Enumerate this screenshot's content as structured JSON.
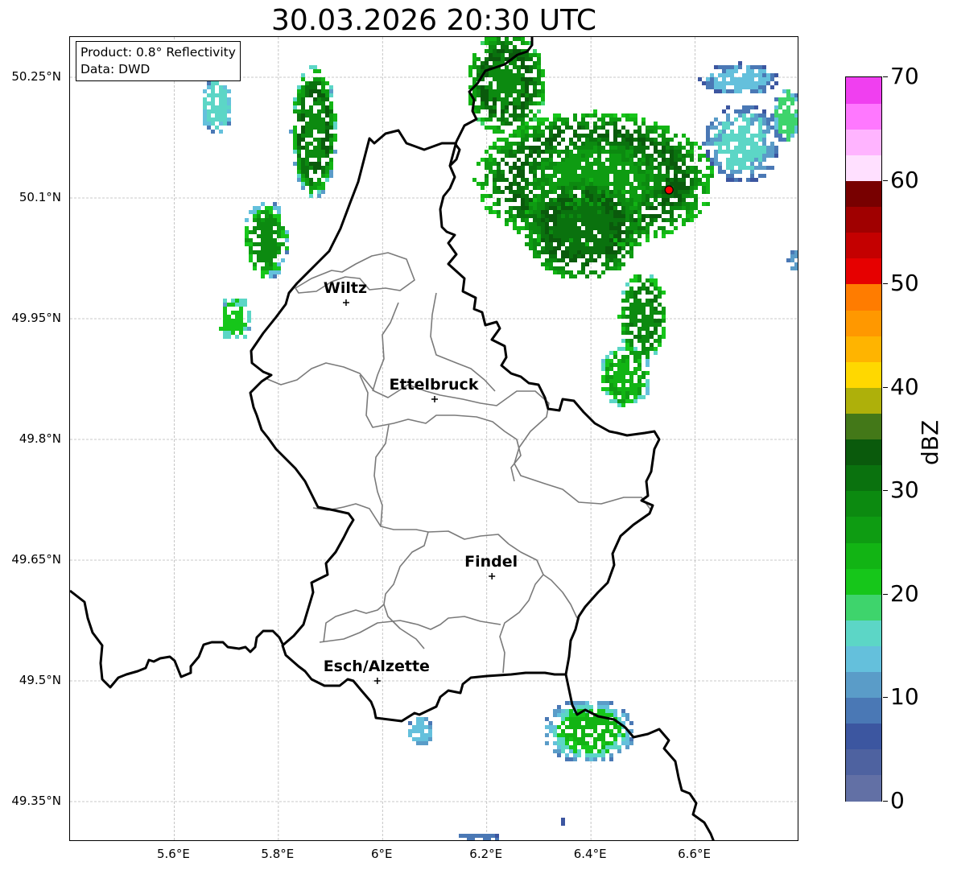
{
  "title": "30.03.2026 20:30 UTC",
  "info": {
    "product": "Product: 0.8° Reflectivity",
    "data": "Data: DWD"
  },
  "axes": {
    "y_ticks": [
      "50.25°N",
      "50.1°N",
      "49.95°N",
      "49.8°N",
      "49.65°N",
      "49.5°N",
      "49.35°N"
    ],
    "x_ticks": [
      "5.6°E",
      "5.8°E",
      "6°E",
      "6.2°E",
      "6.4°E",
      "6.6°E"
    ]
  },
  "cities": [
    {
      "name": "Wiltz",
      "lon": 5.93,
      "lat": 49.97
    },
    {
      "name": "Ettelbruck",
      "lon": 6.1,
      "lat": 49.85
    },
    {
      "name": "Findel",
      "lon": 6.21,
      "lat": 49.63
    },
    {
      "name": "Esch/Alzette",
      "lon": 5.99,
      "lat": 49.5
    }
  ],
  "radar_site": {
    "lon": 6.55,
    "lat": 50.11,
    "color": "#ff0000"
  },
  "colorbar": {
    "label": "dBZ",
    "min": 0,
    "max": 70,
    "step": 2.5,
    "ticks": [
      "0",
      "10",
      "20",
      "30",
      "40",
      "50",
      "60",
      "70"
    ],
    "colors": [
      "#6270a5",
      "#4e62a0",
      "#3c56a0",
      "#4a78b5",
      "#5a9cc8",
      "#64c0dc",
      "#5cd6c6",
      "#3ed46c",
      "#16c61a",
      "#12b414",
      "#0e9c12",
      "#0c8a10",
      "#0a720e",
      "#0a5a0c",
      "#437818",
      "#aeb00a",
      "#ffd800",
      "#ffb400",
      "#ff9800",
      "#ff7c00",
      "#e60000",
      "#c40000",
      "#a00000",
      "#780000",
      "#ffe0ff",
      "#ffb4ff",
      "#ff78ff",
      "#f03ff0"
    ]
  },
  "map_extent": {
    "lon_min": 5.4,
    "lon_max": 6.8,
    "lat_min": 49.3,
    "lat_max": 50.3
  },
  "style": {
    "border_color": "#000000",
    "canton_color": "#7a7a7a",
    "grid_color": "#b8b8b8"
  }
}
